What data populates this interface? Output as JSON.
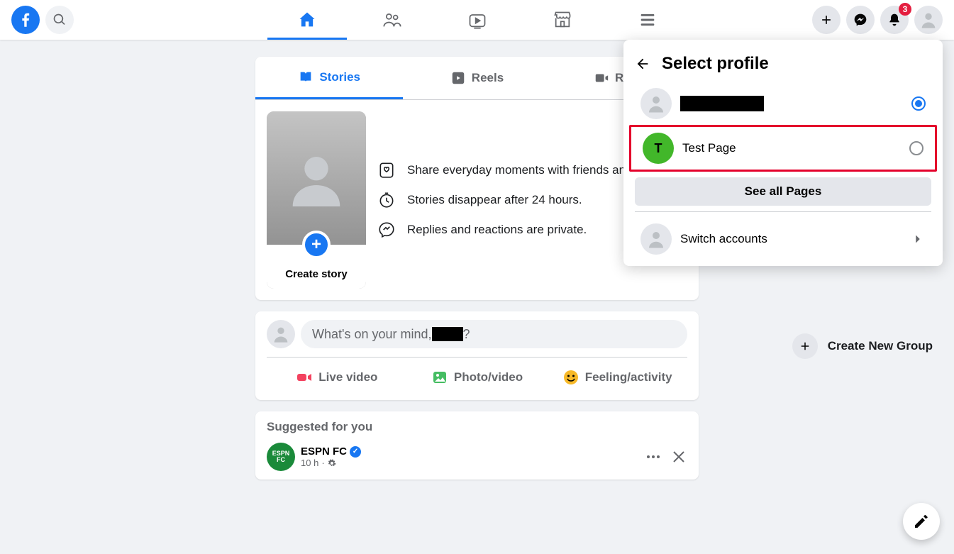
{
  "header": {
    "notification_count": "3"
  },
  "story_tabs": {
    "stories": "Stories",
    "reels": "Reels",
    "rooms": "Rooms"
  },
  "story_card": {
    "create_label": "Create story",
    "info1": "Share everyday moments with friends and family.",
    "info2": "Stories disappear after 24 hours.",
    "info3": "Replies and reactions are private."
  },
  "composer": {
    "placeholder": "What's on your mind, ██?",
    "live": "Live video",
    "photo": "Photo/video",
    "feeling": "Feeling/activity"
  },
  "suggested": {
    "title": "Suggested for you",
    "post": {
      "name": "ESPN FC",
      "time": "10 h",
      "avatar_text": "ESPN FC"
    }
  },
  "dropdown": {
    "title": "Select profile",
    "profile1_name_hidden": true,
    "profile2_name": "Test Page",
    "profile2_letter": "T",
    "see_all": "See all Pages",
    "switch": "Switch accounts"
  },
  "right_rail": {
    "create_group": "Create New Group"
  }
}
